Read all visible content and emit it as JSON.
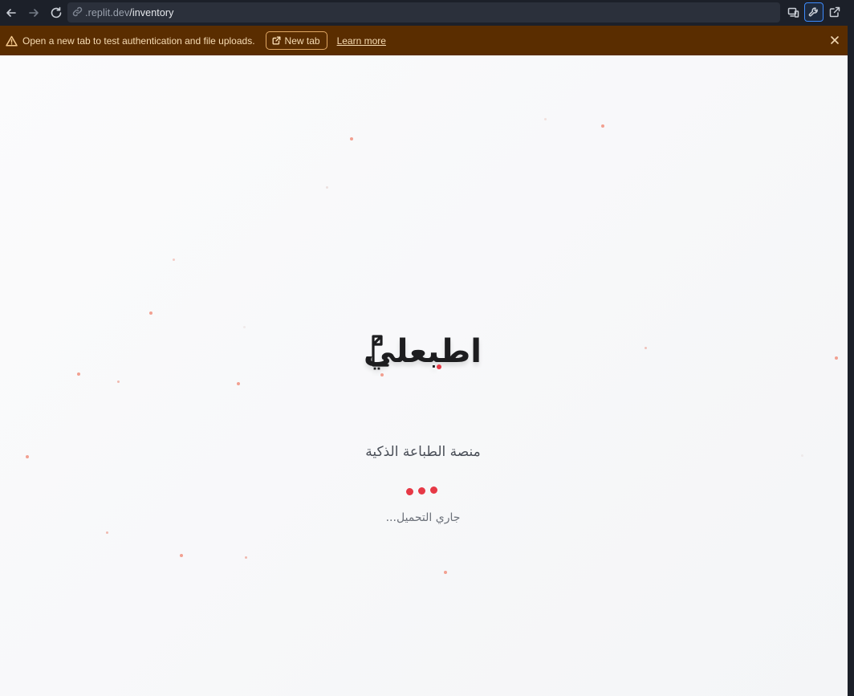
{
  "browser": {
    "url_host": ".replit.dev",
    "url_path": "/inventory",
    "icons": [
      "back-arrow-icon",
      "forward-arrow-icon",
      "reload-icon",
      "link-icon",
      "devices-icon",
      "wrench-icon",
      "external-link-icon"
    ]
  },
  "banner": {
    "message": "Open a new tab to test authentication and file uploads.",
    "new_tab_label": "New tab",
    "learn_more_label": "Learn more",
    "background": "#5a2d00"
  },
  "app": {
    "logo_text": "اطبعلي",
    "tagline": "منصة الطباعة الذكية",
    "loading_text": "جاري التحميل...",
    "accent_color": "#e63946"
  }
}
